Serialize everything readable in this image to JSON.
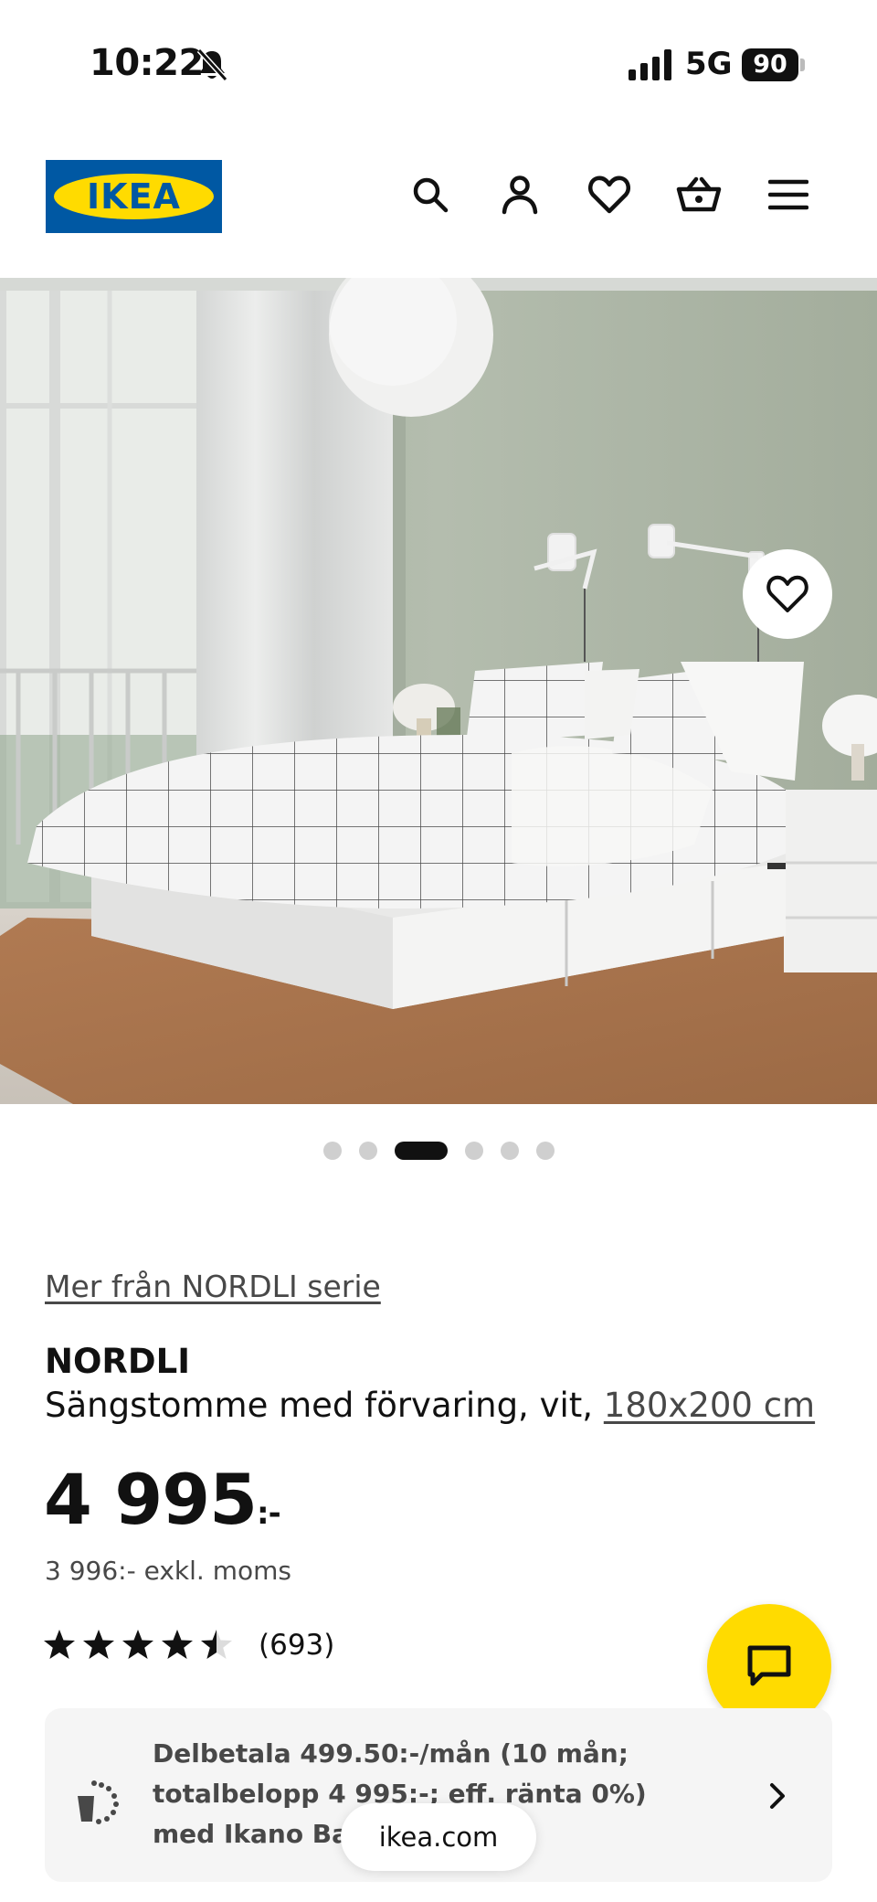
{
  "status_bar": {
    "time": "10:22",
    "network": "5G",
    "battery": "90"
  },
  "header": {
    "logo_text": "IKEA",
    "logo_colors": {
      "blue": "#0058a3",
      "yellow": "#ffdb00"
    },
    "icons": [
      "search-icon",
      "user-icon",
      "heart-icon",
      "basket-icon",
      "menu-icon"
    ]
  },
  "gallery": {
    "image_count": 6,
    "active_index": 2
  },
  "product": {
    "series_link": "Mer från NORDLI serie",
    "name": "NORDLI",
    "description": "Sängstomme med förvaring, vit, ",
    "size_link": "180x200 cm",
    "price": "4 995",
    "price_suffix": ":-",
    "price_ex_vat": "3 996:- exkl. moms",
    "rating_value": 4.5,
    "rating_count": "(693)"
  },
  "financing": {
    "text": "Delbetala 499.50:-/mån (10 mån; totalbelopp 4 995:-; eff. ränta 0%) med Ikano Bank"
  },
  "browser": {
    "url": "ikea.com"
  },
  "colors": {
    "accent_yellow": "#ffdb00",
    "text_dark": "#111111",
    "text_muted": "#484848"
  }
}
